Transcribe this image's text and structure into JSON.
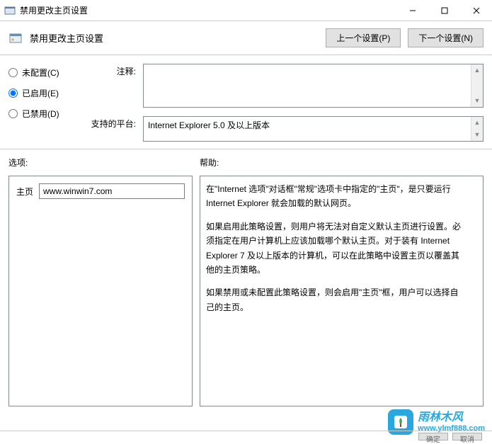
{
  "window": {
    "title": "禁用更改主页设置"
  },
  "header": {
    "title": "禁用更改主页设置",
    "prev_setting": "上一个设置(P)",
    "next_setting": "下一个设置(N)"
  },
  "radios": {
    "not_configured": "未配置(C)",
    "enabled": "已启用(E)",
    "disabled": "已禁用(D)",
    "selected": "enabled"
  },
  "labels": {
    "comment": "注释:",
    "platform": "支持的平台:",
    "options": "选项:",
    "help": "帮助:",
    "homepage": "主页"
  },
  "platform_text": "Internet Explorer 5.0 及以上版本",
  "options": {
    "homepage_value": "www.winwin7.com"
  },
  "help": {
    "p1": "在\"Internet 选项\"对话框\"常规\"选项卡中指定的\"主页\"，是只要运行 Internet Explorer 就会加载的默认网页。",
    "p2": "如果启用此策略设置，则用户将无法对自定义默认主页进行设置。必须指定在用户计算机上应该加载哪个默认主页。对于装有 Internet Explorer 7 及以上版本的计算机，可以在此策略中设置主页以覆盖其他的主页策略。",
    "p3": "如果禁用或未配置此策略设置，则会启用\"主页\"框，用户可以选择自己的主页。"
  },
  "watermark": {
    "brand": "雨林木风",
    "url": "www.ylmf888.com"
  },
  "footer": {
    "confirm": "确定",
    "cancel": "取消"
  }
}
